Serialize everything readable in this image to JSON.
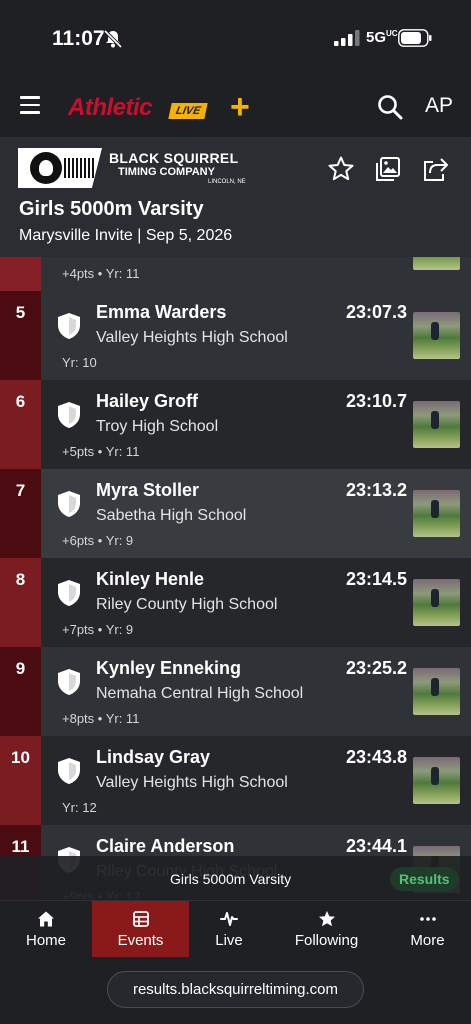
{
  "status_bar": {
    "time": "11:07",
    "network": "5G",
    "network_suffix": "UC"
  },
  "app": {
    "brand": "Athletic",
    "brand_badge": "LIVE",
    "brand_plus": "+",
    "avatar_initials": "AP"
  },
  "company": {
    "name": "BLACK SQUIRREL",
    "subtitle": "TIMING COMPANY",
    "location": "LINCOLN, NE"
  },
  "event": {
    "title": "Girls 5000m Varsity",
    "subtitle": "Marysville Invite | Sep 5, 2026"
  },
  "colors": {
    "rank_dark": "#4a0c10",
    "rank_mid": "#7a1c20",
    "rank_light": "#852126",
    "row_dark": "#25272b",
    "row_mid": "#2f3236",
    "row_light": "#383b40"
  },
  "results": [
    {
      "rank": "",
      "name": "",
      "school": "",
      "time": "",
      "meta": "+4pts • Yr: 11"
    },
    {
      "rank": "5",
      "name": "Emma Warders",
      "school": "Valley Heights High School",
      "time": "23:07.3",
      "meta": "Yr: 10"
    },
    {
      "rank": "6",
      "name": "Hailey Groff",
      "school": "Troy High School",
      "time": "23:10.7",
      "meta": "+5pts • Yr: 11"
    },
    {
      "rank": "7",
      "name": "Myra Stoller",
      "school": "Sabetha High School",
      "time": "23:13.2",
      "meta": "+6pts • Yr: 9"
    },
    {
      "rank": "8",
      "name": "Kinley Henle",
      "school": "Riley County High School",
      "time": "23:14.5",
      "meta": "+7pts • Yr: 9"
    },
    {
      "rank": "9",
      "name": "Kynley Enneking",
      "school": "Nemaha Central High School",
      "time": "23:25.2",
      "meta": "+8pts • Yr: 11"
    },
    {
      "rank": "10",
      "name": "Lindsay Gray",
      "school": "Valley Heights High School",
      "time": "23:43.8",
      "meta": "Yr: 12"
    },
    {
      "rank": "11",
      "name": "Claire Anderson",
      "school": "Riley County High School",
      "time": "23:44.1",
      "meta": "+9pts • Yr: 12"
    }
  ],
  "race_bar": {
    "title": "Girls 5000m Varsity",
    "button": "Results"
  },
  "tabs": [
    {
      "label": "Home",
      "icon": "home-icon"
    },
    {
      "label": "Events",
      "icon": "events-icon"
    },
    {
      "label": "Live",
      "icon": "live-icon"
    },
    {
      "label": "Following",
      "icon": "star-icon"
    },
    {
      "label": "More",
      "icon": "more-icon"
    }
  ],
  "url": "results.blacksquirreltiming.com"
}
